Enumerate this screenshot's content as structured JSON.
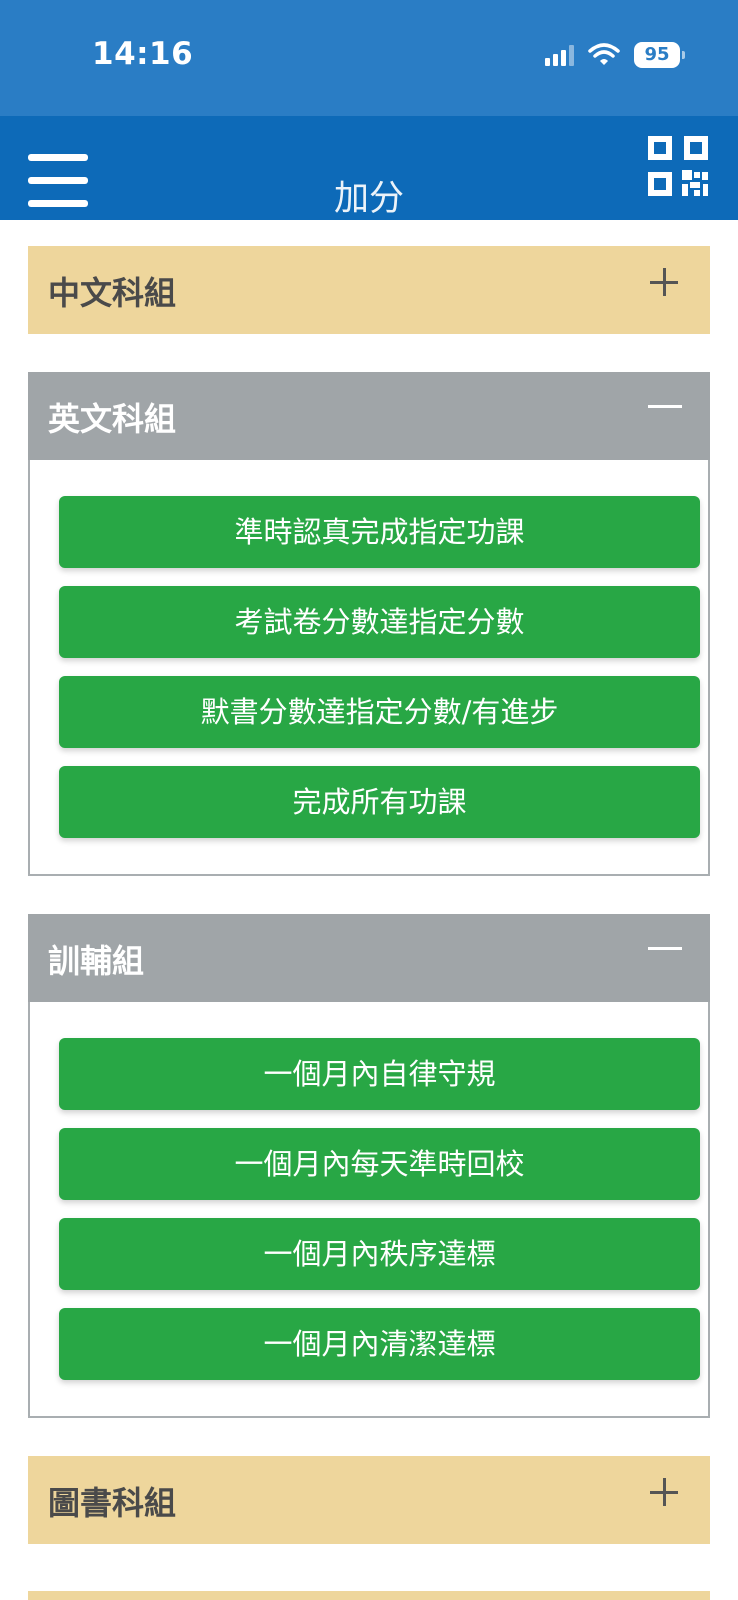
{
  "status_bar": {
    "time": "14:16",
    "battery": "95",
    "icons": [
      "signal-icon",
      "wifi-icon",
      "battery-icon"
    ]
  },
  "app_bar": {
    "title": "加分",
    "menu_icon": "hamburger-menu-icon",
    "qr_icon": "qr-code-icon",
    "color": "#0d6ab8"
  },
  "panels": [
    {
      "title": "中文科組",
      "state": "collapsed",
      "buttons": []
    },
    {
      "title": "英文科組",
      "state": "expanded",
      "buttons": [
        "準時認真完成指定功課",
        "考試卷分數達指定分數",
        "默書分數達指定分數/有進步",
        "完成所有功課"
      ]
    },
    {
      "title": "訓輔組",
      "state": "expanded",
      "buttons": [
        "一個月內自律守規",
        "一個月內每天準時回校",
        "一個月內秩序達標",
        "一個月內清潔達標"
      ]
    },
    {
      "title": "圖書科組",
      "state": "collapsed",
      "buttons": []
    }
  ],
  "colors": {
    "collapsed_header": "#eed69c",
    "expanded_header": "#a0a5a8",
    "button": "#28a745",
    "status_bar": "#2a7dc5"
  }
}
